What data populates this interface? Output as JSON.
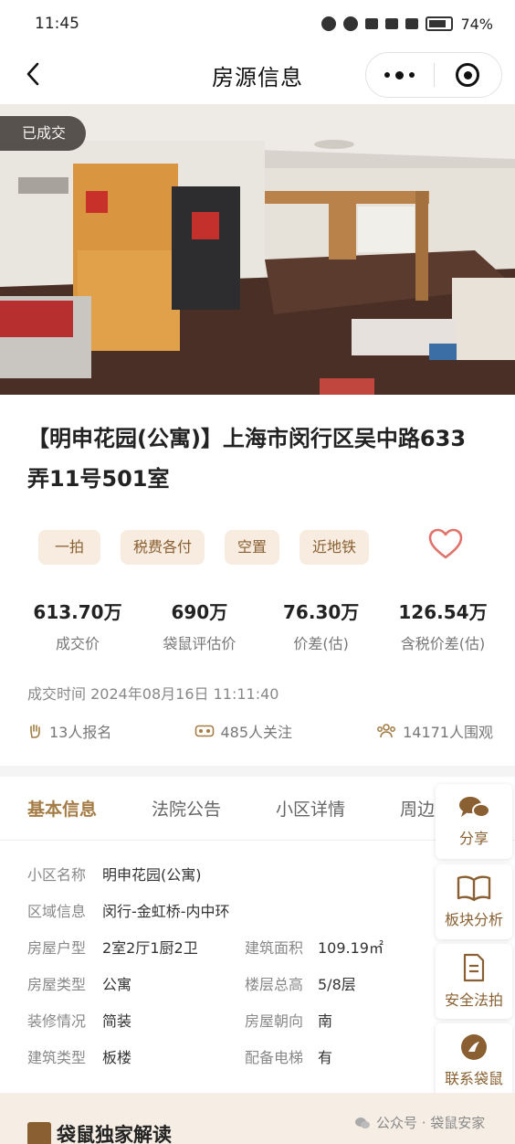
{
  "status_bar": {
    "time": "11:45",
    "battery": "74%"
  },
  "nav": {
    "title": "房源信息"
  },
  "photo": {
    "badge": "已成交"
  },
  "listing": {
    "title": "【明申花园(公寓)】上海市闵行区吴中路633弄11号501室"
  },
  "tags": [
    "一拍",
    "税费各付",
    "空置",
    "近地铁"
  ],
  "stats": [
    {
      "value": "613.70万",
      "label": "成交价"
    },
    {
      "value": "690万",
      "label": "袋鼠评估价"
    },
    {
      "value": "76.30万",
      "label": "价差(估)"
    },
    {
      "value": "126.54万",
      "label": "含税价差(估)"
    }
  ],
  "deal_time": "成交时间 2024年08月16日 11:11:40",
  "metrics": {
    "signups": "13人报名",
    "followers": "485人关注",
    "viewers": "14171人围观"
  },
  "tabs": [
    "基本信息",
    "法院公告",
    "小区详情",
    "周边"
  ],
  "info": {
    "community_label": "小区名称",
    "community": "明申花园(公寓)",
    "area_label": "区域信息",
    "area": "闵行-金虹桥-内中环",
    "layout_label": "房屋户型",
    "layout": "2室2厅1厨2卫",
    "size_label": "建筑面积",
    "size": "109.19㎡",
    "type_label": "房屋类型",
    "type": "公寓",
    "floor_label": "楼层总高",
    "floor": "5/8层",
    "decor_label": "装修情况",
    "decor": "简装",
    "orient_label": "房屋朝向",
    "orient": "南",
    "build_label": "建筑类型",
    "build": "板楼",
    "elevator_label": "配备电梯",
    "elevator": "有"
  },
  "side_buttons": {
    "share": "分享",
    "analysis": "板块分析",
    "legal": "安全法拍",
    "contact": "联系袋鼠"
  },
  "bottom": {
    "exclusive": "袋鼠独家解读",
    "watermark": "公众号 · 袋鼠安家"
  },
  "colors": {
    "accent": "#a47c44",
    "tag_bg": "#f7ecdf",
    "heart": "#e0736b"
  }
}
